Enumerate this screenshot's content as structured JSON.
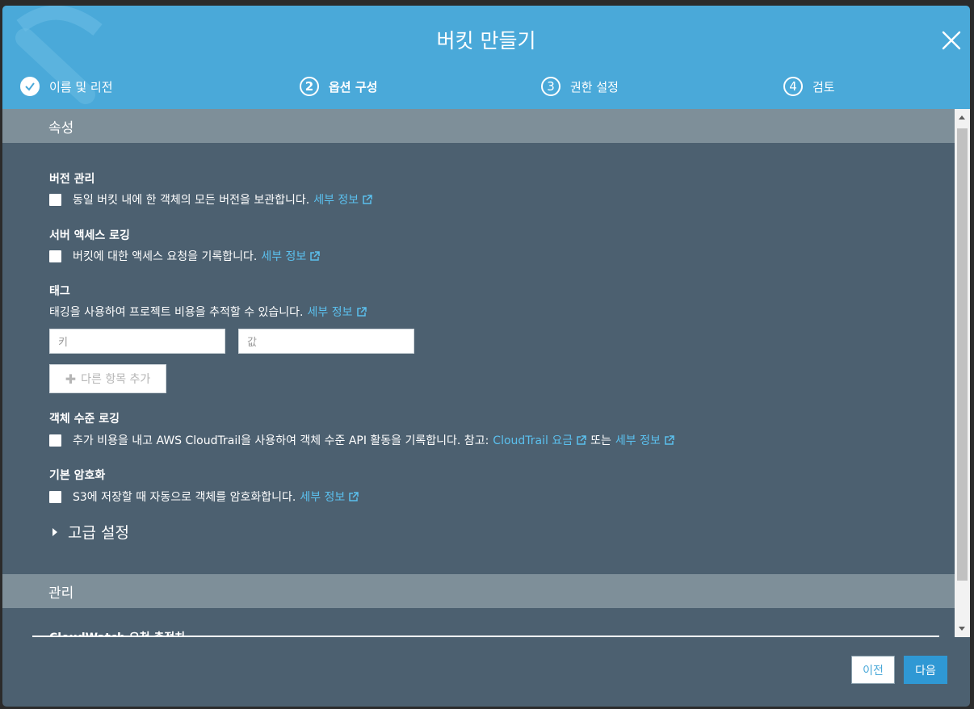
{
  "dialog": {
    "title": "버킷 만들기"
  },
  "steps": [
    {
      "label": "이름 및 리전",
      "number": ""
    },
    {
      "label": "옵션 구성",
      "number": "2"
    },
    {
      "label": "권한 설정",
      "number": "3"
    },
    {
      "label": "검토",
      "number": "4"
    }
  ],
  "properties": {
    "header": "속성",
    "versioning": {
      "title": "버전 관리",
      "text": "동일 버킷 내에 한 객체의 모든 버전을 보관합니다.",
      "link": "세부 정보"
    },
    "logging": {
      "title": "서버 액세스 로깅",
      "text": "버킷에 대한 액세스 요청을 기록합니다.",
      "link": "세부 정보"
    },
    "tags": {
      "title": "태그",
      "text": "태깅을 사용하여 프로젝트 비용을 추적할 수 있습니다.",
      "link": "세부 정보",
      "key_placeholder": "키",
      "value_placeholder": "값",
      "add_label": "다른 항목 추가"
    },
    "object_logging": {
      "title": "객체 수준 로깅",
      "text": "추가 비용을 내고 AWS CloudTrail을 사용하여 객체 수준 API 활동을 기록합니다. 참고:",
      "link1": "CloudTrail 요금",
      "middle": "또는",
      "link2": "세부 정보"
    },
    "encryption": {
      "title": "기본 암호화",
      "text": "S3에 저장할 때 자동으로 객체를 암호화합니다.",
      "link": "세부 정보"
    },
    "advanced": "고급 설정"
  },
  "management": {
    "header": "관리",
    "cut_item": "CloudWatch 요청 측정치"
  },
  "footer": {
    "prev": "이전",
    "next": "다음"
  },
  "colors": {
    "header_bg": "#4aa9d9",
    "panel_bg": "#4c6070",
    "section_bg": "#7e8f99",
    "link": "#5bc0ee",
    "primary": "#2f98d4"
  }
}
